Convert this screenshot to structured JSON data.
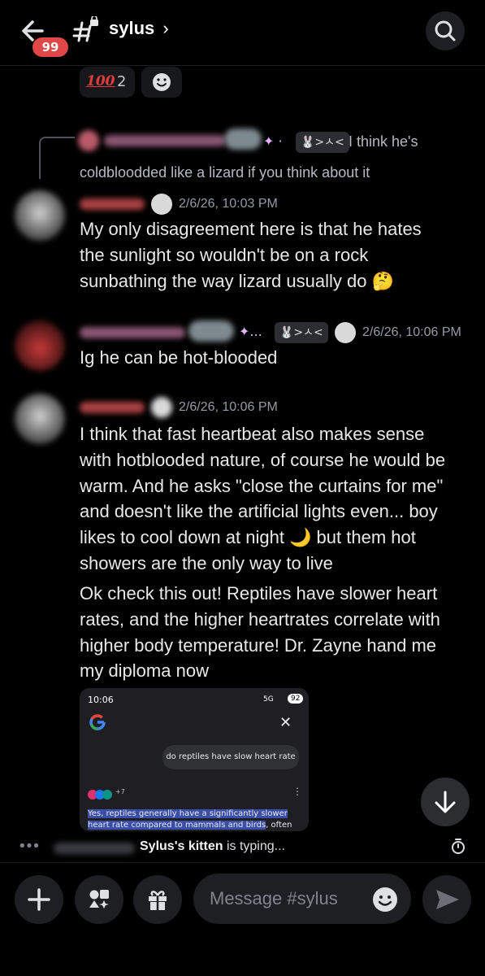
{
  "header": {
    "badge_count": "99",
    "channel_name": "sylus",
    "channel_chevron": "›"
  },
  "reactions": [
    {
      "emoji": "100",
      "count": "2"
    }
  ],
  "reply": {
    "tag_text": "🐰>ㅅ<",
    "text_line1": "I think he's",
    "text_line2": "coldbloodded like a lizard if you think about it"
  },
  "messages": [
    {
      "time": "2/6/26, 10:03 PM",
      "lines": [
        "My only disagreement here is that he hates",
        "the sunlight so wouldn't be on a rock",
        "sunbathing the way lizard usually do 🤔"
      ]
    },
    {
      "tag_text": "🐰>ㅅ<",
      "time": "2/6/26, 10:06 PM",
      "lines": [
        "Ig he can be hot-blooded"
      ]
    },
    {
      "time": "2/6/26, 10:06 PM",
      "lines": [
        "I think that fast heartbeat also makes sense",
        "with hotblooded nature, of course he would be",
        "warm. And he asks \"close the curtains for me\"",
        "and doesn't like the artificial lights even... boy",
        "likes to cool down at night 🌙 but them hot",
        "showers are the only way to live"
      ],
      "lines2": [
        "Ok check this out! Reptiles have slower heart",
        "rates, and the higher heartrates correlate with",
        "higher body temperature! Dr. Zayne hand me",
        "my diploma now"
      ]
    }
  ],
  "attachment": {
    "status_time": "10:06",
    "status_right": "5G",
    "battery": "92",
    "query": "do reptiles have slow heart rate",
    "source_count": "+7",
    "highlight": "Yes, reptiles generally have a significantly slower heart rate compared to mammals and birds",
    "rest": ", often beating only"
  },
  "typing": {
    "user": "Sylus's kitten",
    "suffix": " is typing..."
  },
  "composer": {
    "placeholder": "Message #sylus"
  },
  "colors": {
    "badge": "#e04848",
    "background": "#000000",
    "surface": "#1e1f22"
  }
}
